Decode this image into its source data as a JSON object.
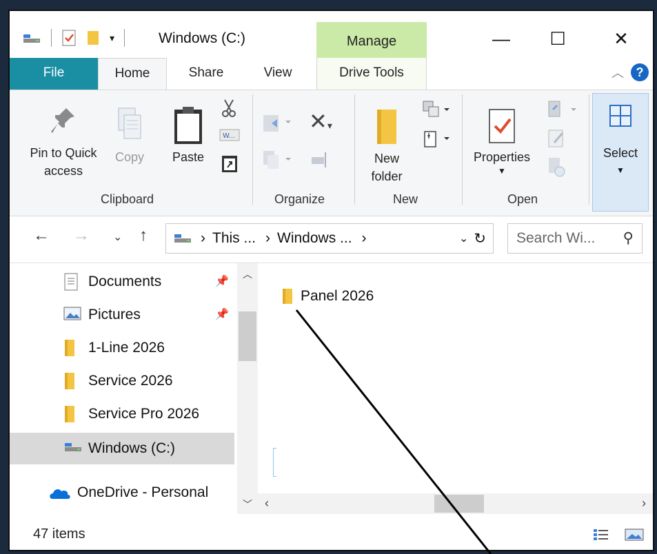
{
  "window": {
    "title": "Windows (C:)",
    "contextual_tab": "Manage",
    "minimize": "—",
    "maximize": "☐",
    "close": "✕"
  },
  "ribbon_tabs": {
    "file": "File",
    "home": "Home",
    "share": "Share",
    "view": "View",
    "drive_tools": "Drive Tools",
    "help": "?"
  },
  "ribbon": {
    "clipboard": {
      "label": "Clipboard",
      "pin_line1": "Pin to Quick",
      "pin_line2": "access",
      "copy": "Copy",
      "paste": "Paste"
    },
    "organize": {
      "label": "Organize"
    },
    "new": {
      "label": "New",
      "new_folder_line1": "New",
      "new_folder_line2": "folder"
    },
    "open": {
      "label": "Open",
      "properties": "Properties"
    },
    "select": {
      "label": "Select"
    }
  },
  "address": {
    "crumb1": "This ...",
    "crumb2": "Windows ...",
    "search_placeholder": "Search Wi..."
  },
  "nav_pane": {
    "items": [
      {
        "label": "Documents",
        "pinned": true
      },
      {
        "label": "Pictures",
        "pinned": true
      },
      {
        "label": "1-Line 2026"
      },
      {
        "label": "Service 2026"
      },
      {
        "label": "Service Pro 2026"
      },
      {
        "label": "Windows (C:)",
        "selected": true
      },
      {
        "label": "OneDrive - Personal"
      }
    ]
  },
  "content": {
    "items": [
      {
        "label": "Panel 2026",
        "type": "folder"
      }
    ]
  },
  "status": {
    "count": "47 items"
  },
  "colors": {
    "file_tab": "#1a8fa3",
    "manage_tab": "#cbeaa8",
    "folder": "#f4c542",
    "accent": "#1666c5",
    "onedrive": "#0a6fd8"
  }
}
